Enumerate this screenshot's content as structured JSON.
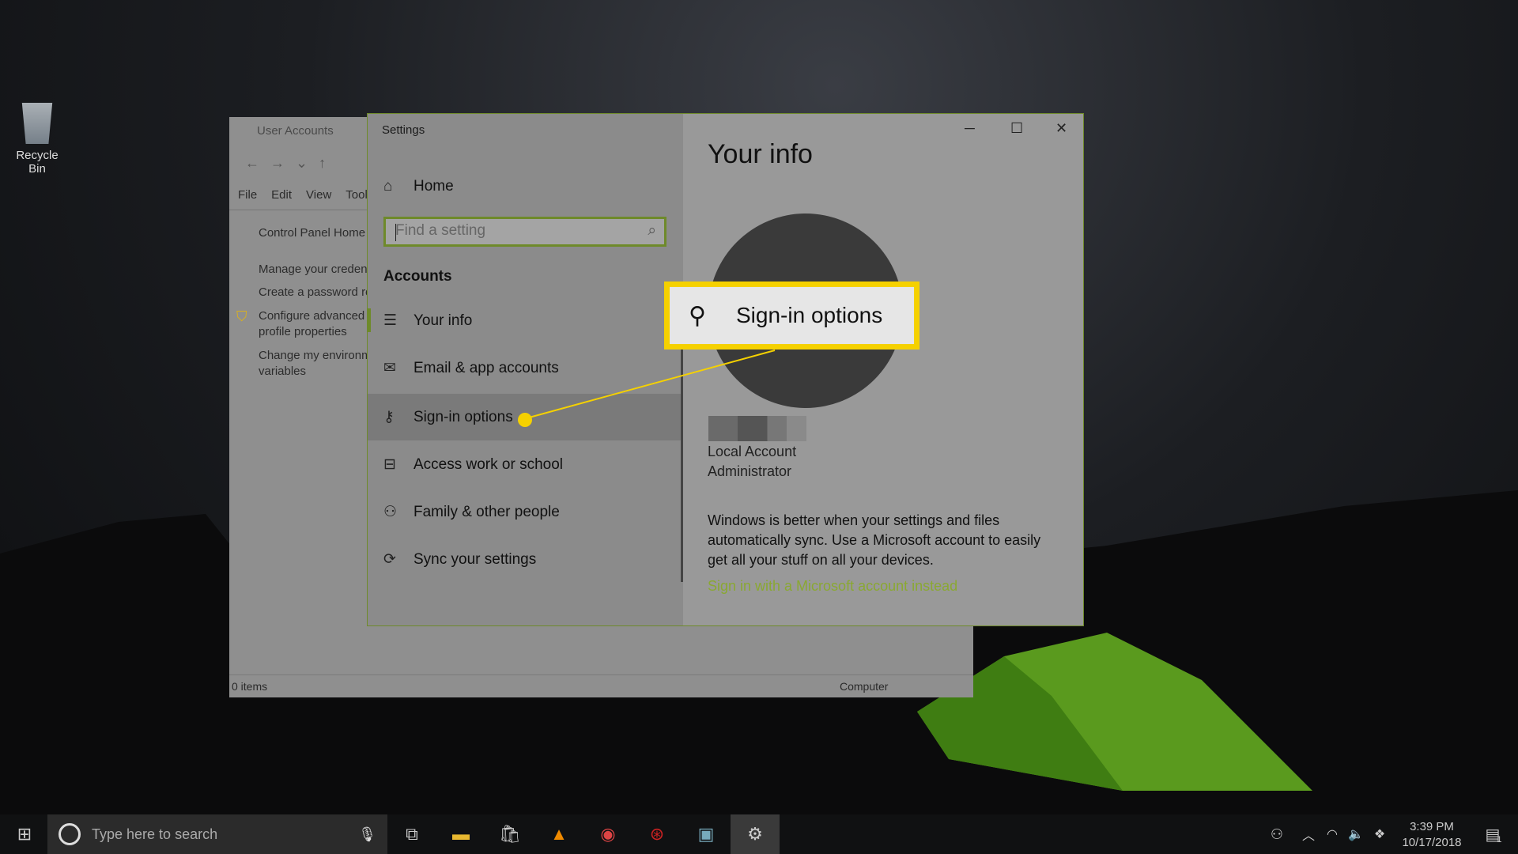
{
  "desktop": {
    "recycle_bin": "Recycle Bin"
  },
  "user_accounts": {
    "title": "User Accounts",
    "menu": [
      "File",
      "Edit",
      "View",
      "Tools"
    ],
    "links": [
      "Control Panel Home",
      "Manage your creden",
      "Create a password re",
      "Configure advanced",
      "profile properties",
      "Change my environm",
      "variables"
    ],
    "status_items": "0 items",
    "status_location": "Computer"
  },
  "settings": {
    "title": "Settings",
    "home": "Home",
    "search_placeholder": "Find a setting",
    "section": "Accounts",
    "items": [
      {
        "label": "Your info",
        "icon": "person-list-icon"
      },
      {
        "label": "Email & app accounts",
        "icon": "mail-icon"
      },
      {
        "label": "Sign-in options",
        "icon": "key-icon"
      },
      {
        "label": "Access work or school",
        "icon": "briefcase-icon"
      },
      {
        "label": "Family & other people",
        "icon": "person-add-icon"
      },
      {
        "label": "Sync your settings",
        "icon": "sync-icon"
      }
    ],
    "selected": "Sign-in options",
    "page_title": "Your info",
    "account_type": "Local Account",
    "role": "Administrator",
    "sync_text": "Windows is better when your settings and files automatically sync. Use a Microsoft account to easily get all your stuff on all your devices.",
    "ms_link": "Sign in with a Microsoft account instead"
  },
  "callout": {
    "label": "Sign-in options",
    "color": "#f5d100"
  },
  "taskbar": {
    "search_placeholder": "Type here to search",
    "time": "3:39 PM",
    "date": "10/17/2018",
    "notifications": "1"
  },
  "colors": {
    "accent": "#6e8a2a",
    "link": "#8aa832",
    "highlight": "#f5d100"
  }
}
